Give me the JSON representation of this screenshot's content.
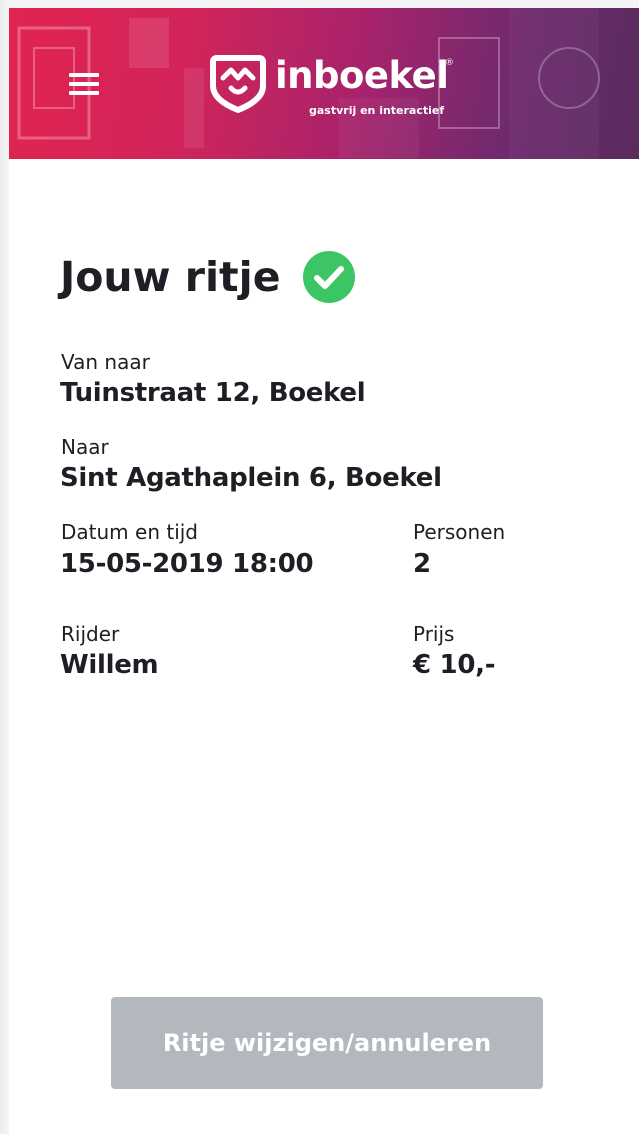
{
  "header": {
    "brand_name": "inboekel",
    "brand_registered": "®",
    "tagline": "gastvrij en interactief"
  },
  "ride": {
    "title": "Jouw ritje",
    "status": "confirmed",
    "from_label": "Van naar",
    "from_value": "Tuinstraat 12, Boekel",
    "to_label": "Naar",
    "to_value": "Sint Agathaplein 6, Boekel",
    "datetime_label": "Datum en tijd",
    "datetime_value": "15-05-2019 18:00",
    "persons_label": "Personen",
    "persons_value": "2",
    "driver_label": "Rijder",
    "driver_value": "Willem",
    "price_label": "Prijs",
    "price_value": "€ 10,-"
  },
  "actions": {
    "edit_cancel_label": "Ritje wijzigen/annuleren"
  },
  "icons": {
    "menu": "hamburger-menu-icon",
    "logo": "heart-shield-logo-icon",
    "status": "check-circle-icon"
  },
  "colors": {
    "header_start": "#e2244f",
    "header_end": "#5a2b5e",
    "check_green": "#3cc565",
    "button_bg": "#b3b7be",
    "text": "#1e1e24"
  }
}
